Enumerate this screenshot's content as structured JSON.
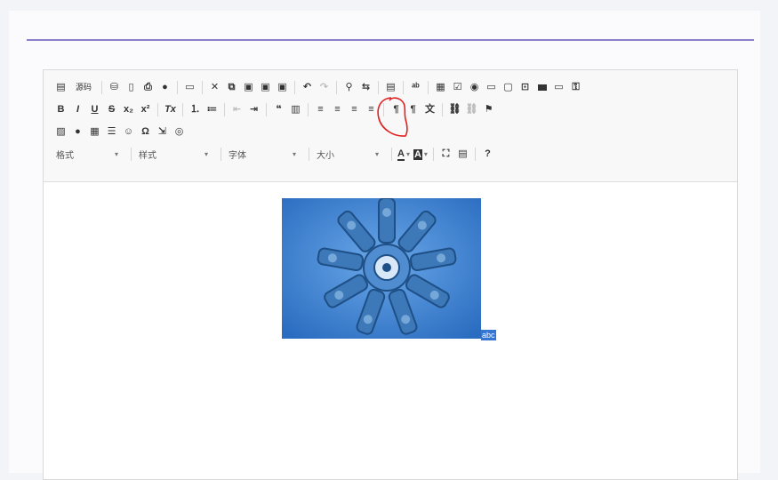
{
  "toolbar": {
    "source_label": "源码",
    "combos": [
      {
        "label": "格式"
      },
      {
        "label": "样式"
      },
      {
        "label": "字体"
      },
      {
        "label": "大小"
      }
    ],
    "text_color_label": "A",
    "bg_color_label": "A",
    "help_label": "?"
  },
  "content": {
    "selected_text": "abc"
  },
  "colors": {
    "accent": "#8b7fc9",
    "selection": "#3476d6",
    "annotation": "#e02020"
  }
}
